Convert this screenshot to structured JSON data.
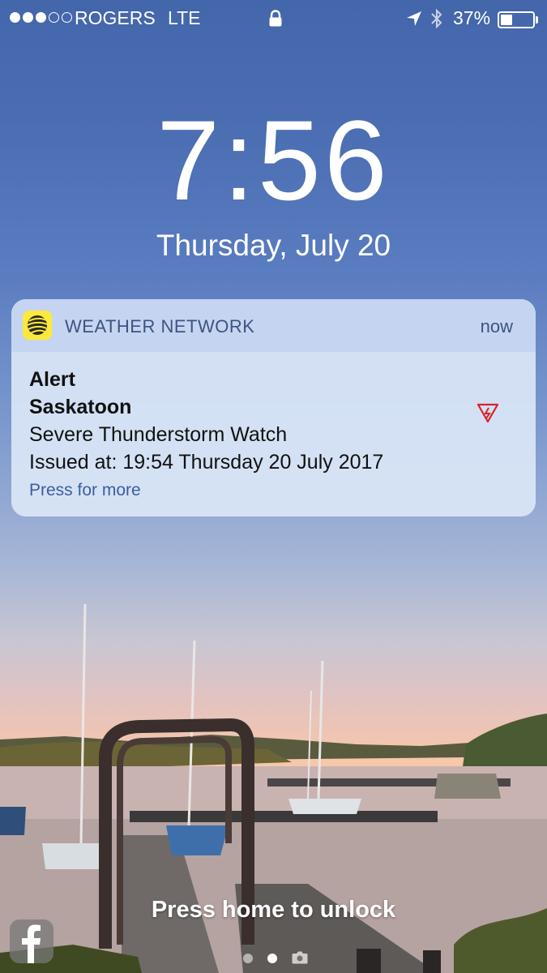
{
  "status_bar": {
    "signal_bars_filled": 3,
    "signal_bars_total": 5,
    "carrier": "ROGERS",
    "network": "LTE",
    "battery_percent": "37%",
    "battery_level": 0.37,
    "icons": [
      "lock-icon",
      "location-icon",
      "bluetooth-icon",
      "battery-icon"
    ]
  },
  "lock_screen": {
    "time": "7:56",
    "date": "Thursday, July 20"
  },
  "notification": {
    "app_name": "WEATHER NETWORK",
    "time_ago": "now",
    "title": "Alert",
    "location": "Saskatoon",
    "message": "Severe Thunderstorm Watch",
    "issued": "Issued at: 19:54 Thursday 20 July 2017",
    "action_hint": "Press for more",
    "app_icon": "weather-network-logo-icon",
    "alert_icon": "thunderstorm-alert-icon",
    "alert_color": "#d9232a",
    "app_icon_color": "#fde93a"
  },
  "footer": {
    "unlock_text": "Press home to unlock",
    "dock_icon": "facebook-icon",
    "page_indicator_active": 2,
    "page_indicator_total": 2,
    "camera_icon": "camera-icon"
  }
}
